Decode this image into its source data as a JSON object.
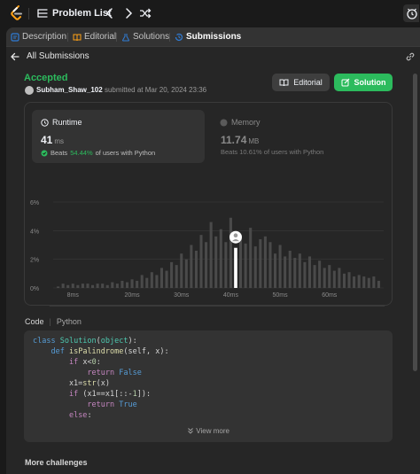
{
  "topbar": {
    "problem_list_label": "Problem List"
  },
  "tabs": [
    {
      "label": "Description",
      "icon": "description-icon"
    },
    {
      "label": "Editorial",
      "icon": "book-icon"
    },
    {
      "label": "Solutions",
      "icon": "flask-icon"
    },
    {
      "label": "Submissions",
      "icon": "history-icon",
      "active": true
    }
  ],
  "back": {
    "label": "All Submissions"
  },
  "submission": {
    "status": "Accepted",
    "status_color": "#2cbb5d",
    "user": "Subham_Shaw_102",
    "submitted_text": "submitted at Mar 20, 2024 23:36"
  },
  "buttons": {
    "editorial": "Editorial",
    "solution": "Solution"
  },
  "runtime": {
    "title": "Runtime",
    "value": "41",
    "unit": "ms",
    "beats_prefix": "Beats",
    "beats_pct": "54.44%",
    "beats_suffix": "of users with Python"
  },
  "memory": {
    "title": "Memory",
    "value": "11.74",
    "unit": "MB",
    "beats_text": "Beats 10.61% of users with Python"
  },
  "chart_data": {
    "type": "bar",
    "y_ticks": [
      "6%",
      "4%",
      "2%",
      "0%"
    ],
    "ylim": [
      0,
      6
    ],
    "x_ticks": [
      "8ms",
      "20ms",
      "30ms",
      "40ms",
      "50ms",
      "60ms"
    ],
    "xlim": [
      4,
      71
    ],
    "x": [
      5,
      6,
      7,
      8,
      9,
      10,
      11,
      12,
      13,
      14,
      15,
      16,
      17,
      18,
      19,
      20,
      21,
      22,
      23,
      24,
      25,
      26,
      27,
      28,
      29,
      30,
      31,
      32,
      33,
      34,
      35,
      36,
      37,
      38,
      39,
      40,
      41,
      42,
      43,
      44,
      45,
      46,
      47,
      48,
      49,
      50,
      51,
      52,
      53,
      54,
      55,
      56,
      57,
      58,
      59,
      60,
      61,
      62,
      63,
      64,
      65,
      66,
      67,
      68,
      69,
      70
    ],
    "values": [
      0.1,
      0.3,
      0.2,
      0.3,
      0.2,
      0.3,
      0.3,
      0.2,
      0.3,
      0.3,
      0.2,
      0.4,
      0.3,
      0.5,
      0.4,
      0.6,
      0.5,
      0.9,
      0.7,
      1.1,
      0.9,
      1.4,
      1.2,
      1.8,
      1.6,
      2.4,
      2.0,
      3.0,
      2.6,
      3.7,
      3.2,
      4.6,
      3.6,
      4.1,
      3.2,
      4.9,
      2.6,
      3.7,
      3.1,
      4.2,
      2.9,
      3.4,
      3.6,
      3.2,
      2.4,
      3.0,
      2.2,
      2.6,
      2.1,
      2.4,
      1.8,
      2.2,
      1.6,
      1.9,
      1.4,
      1.6,
      1.2,
      1.4,
      1.0,
      1.1,
      0.8,
      0.9,
      0.8,
      0.7,
      0.8,
      0.5
    ],
    "highlight_x": 41,
    "highlight_value": 2.8,
    "bar_color": "#4a4a4a",
    "highlight_color": "#ffffff"
  },
  "code": {
    "tab_label": "Code",
    "language": "Python",
    "view_more": "View more"
  },
  "more_challenges": "More challenges"
}
